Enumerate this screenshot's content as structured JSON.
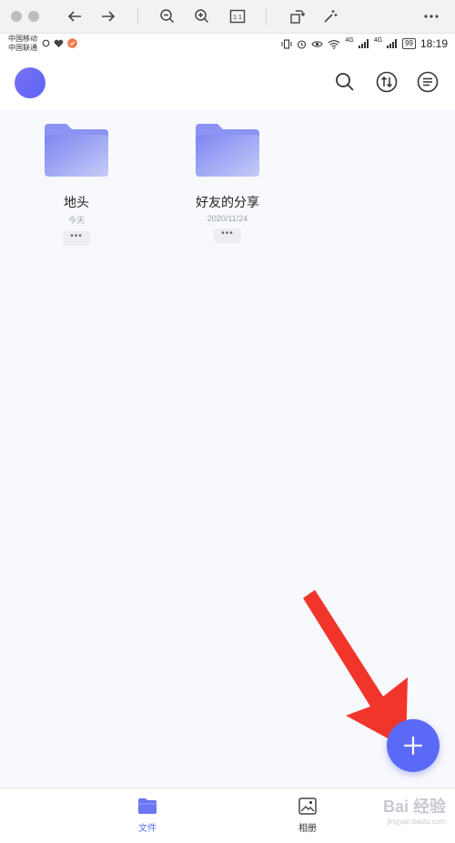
{
  "viewer_toolbar": {
    "icons": [
      "close-circle-icon",
      "block-icon",
      "arrow-left-icon",
      "arrow-right-icon",
      "zoom-out-icon",
      "zoom-in-icon",
      "actual-size-icon",
      "rotate-icon",
      "magic-wand-icon",
      "more-icon"
    ],
    "actual_size_label": "1:1"
  },
  "status_bar": {
    "carrier_1": "中国移动",
    "carrier_2": "中国联通",
    "signal_1": "4G",
    "signal_2": "4G",
    "battery": "99",
    "time": "18:19"
  },
  "header": {
    "icons": [
      "search-icon",
      "transfer-icon",
      "menu-icon"
    ]
  },
  "folders": [
    {
      "name": "地头",
      "date": "今天",
      "more": "•••"
    },
    {
      "name": "好友的分享",
      "date": "2020/11/24",
      "more": "•••"
    }
  ],
  "bottom_nav": {
    "tabs": [
      {
        "label": "文件",
        "icon": "folder-icon",
        "active": true
      },
      {
        "label": "相册",
        "icon": "image-icon",
        "active": false
      }
    ]
  },
  "watermark": {
    "text": "Bai 经验",
    "sub": "jingyan.baidu.com"
  },
  "colors": {
    "accent": "#5b6af6",
    "annotation_arrow": "#f2352b",
    "content_bg": "#f8f9fd"
  }
}
